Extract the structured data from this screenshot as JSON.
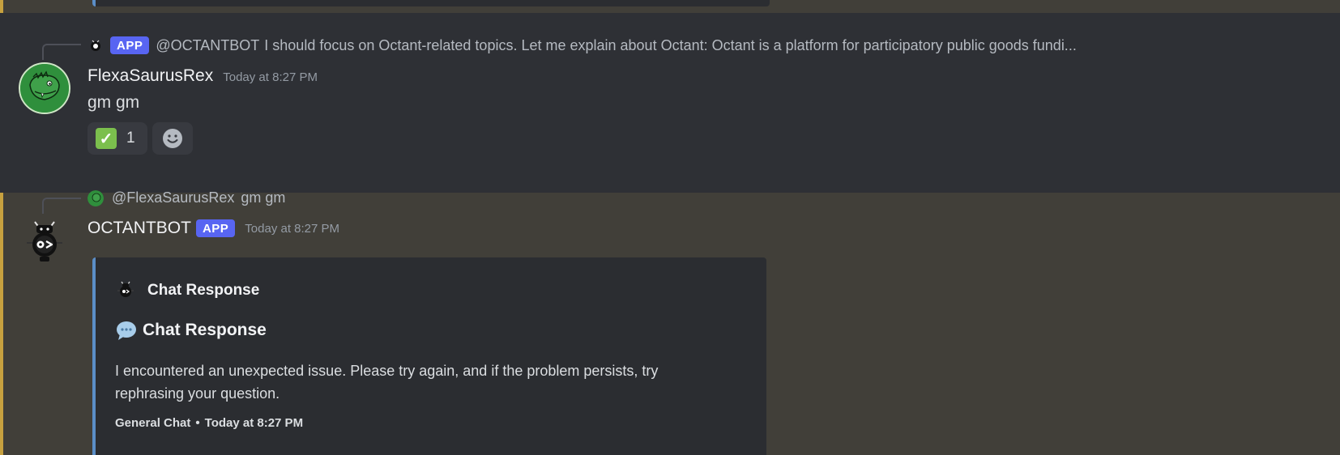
{
  "messages": {
    "first": {
      "reply": {
        "badge": "APP",
        "author": "@OCTANTBOT",
        "text": "I should focus on Octant-related topics. Let me explain about Octant:  Octant is a platform for participatory public goods fundi..."
      },
      "author": "FlexaSaurusRex",
      "timestamp": "Today at 8:27 PM",
      "body": "gm gm",
      "reactions": [
        {
          "emoji": "check-mark-button",
          "count": "1"
        }
      ]
    },
    "second": {
      "reply": {
        "author": "@FlexaSaurusRex",
        "text": "gm gm"
      },
      "author": "OCTANTBOT",
      "badge": "APP",
      "timestamp": "Today at 8:27 PM",
      "embed": {
        "author_name": "Chat Response",
        "title": "Chat Response",
        "description": "I encountered an unexpected issue. Please try again, and if the problem persists, try rephrasing your question.",
        "footer_text": "General Chat",
        "footer_separator": "•",
        "footer_time": "Today at 8:27 PM"
      }
    }
  },
  "colors": {
    "accent": "#5865f2",
    "embed_border": "#5b8ec7",
    "mention_strip": "#c7a13f"
  }
}
